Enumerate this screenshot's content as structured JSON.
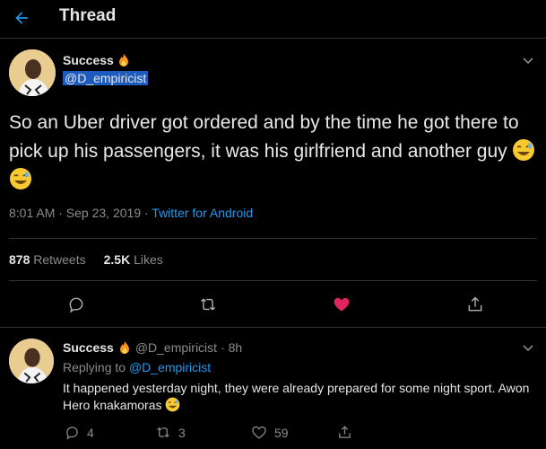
{
  "header": {
    "title": "Thread"
  },
  "main_tweet": {
    "author_name": "Success",
    "author_handle": "@D_empiricist",
    "text": "So an Uber driver got ordered and by the time he got there to pick up his passengers, it was his girlfriend and another guy",
    "timestamp": "8:01 AM · Sep 23, 2019 · ",
    "source": "Twitter for Android",
    "retweets_count": "878",
    "retweets_label": "Retweets",
    "likes_count": "2.5K",
    "likes_label": "Likes",
    "liked": true,
    "like_color": "#e0245e",
    "accent": "#1d9bf0"
  },
  "reply_tweet": {
    "author_name": "Success",
    "author_handle": "@D_empiricist",
    "time_ago": "· 8h",
    "replying_prefix": "Replying to",
    "replying_to": "@D_empiricist",
    "text": "It happened yesterday night, they were already prepared for some night sport. Awon Hero knakamoras",
    "reply_count": "4",
    "retweet_count": "3",
    "like_count": "59"
  },
  "icons": [
    "back-arrow-icon",
    "flame-icon",
    "chevron-down-icon",
    "sweat-smile-emoji-icon",
    "reply-icon",
    "retweet-icon",
    "heart-icon",
    "share-icon"
  ]
}
